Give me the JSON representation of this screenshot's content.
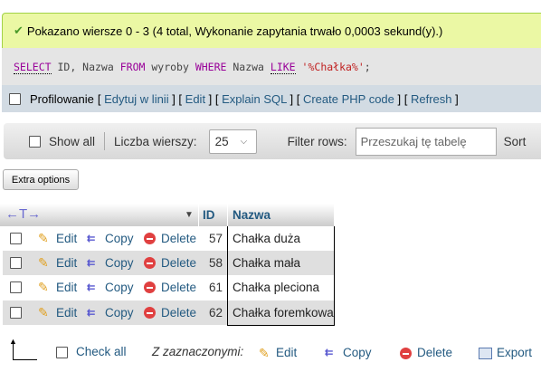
{
  "success": {
    "icon": "check-icon",
    "message": "Pokazano wiersze 0 - 3 (4 total, Wykonanie zapytania trwało 0,0003 sekund(y).)"
  },
  "sql": {
    "select": "SELECT",
    "p1": " ID, Nazwa ",
    "from": "FROM",
    "p2": " wyroby ",
    "where": "WHERE",
    "p3": " Nazwa ",
    "like": "LIKE",
    "p4": " ",
    "str": "'%Chałka%'",
    "p5": ";"
  },
  "profiling": {
    "label": "Profilowanie",
    "links": [
      "Edytuj w linii",
      "Edit",
      "Explain SQL",
      "Create PHP code",
      "Refresh"
    ]
  },
  "toolbar": {
    "show_all": "Show all",
    "rows_label": "Liczba wierszy:",
    "rows_value": "25",
    "filter_label": "Filter rows:",
    "filter_placeholder": "Przeszukaj tę tabelę",
    "sort_label": "Sort"
  },
  "extra_options": "Extra options",
  "table": {
    "headers": {
      "id": "ID",
      "nazwa": "Nazwa"
    },
    "actions": {
      "edit": "Edit",
      "copy": "Copy",
      "delete": "Delete"
    },
    "rows": [
      {
        "id": "57",
        "nazwa": "Chałka duża"
      },
      {
        "id": "58",
        "nazwa": "Chałka mała"
      },
      {
        "id": "61",
        "nazwa": "Chałka pleciona"
      },
      {
        "id": "62",
        "nazwa": "Chałka foremkowa"
      }
    ]
  },
  "bulk": {
    "check_all": "Check all",
    "with_selected": "Z zaznaczonymi:",
    "edit": "Edit",
    "copy": "Copy",
    "delete": "Delete",
    "export": "Export"
  }
}
